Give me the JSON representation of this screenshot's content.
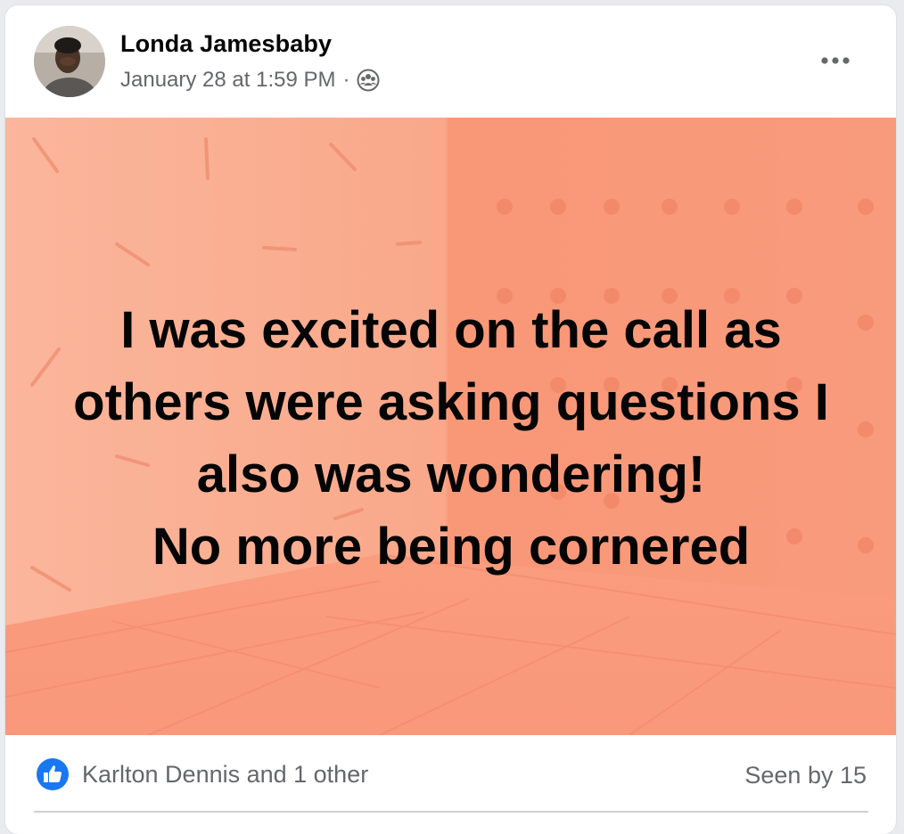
{
  "post": {
    "author": "Londa Jamesbaby",
    "timestamp": "January 28 at 1:59 PM",
    "separator": "·",
    "audience_icon": "group-audience-icon",
    "more_icon": "more-options-icon",
    "text_lines": [
      "I was excited on the call as",
      "others were asking questions I",
      "also was wondering!",
      "No more being cornered"
    ],
    "background_color": "#f9a284"
  },
  "footer": {
    "like_icon": "like-reaction-icon",
    "reactors": "Karlton Dennis and 1 other",
    "seen_by": "Seen by 15"
  },
  "colors": {
    "like_blue": "#1877f2",
    "secondary_text": "#65676b"
  }
}
